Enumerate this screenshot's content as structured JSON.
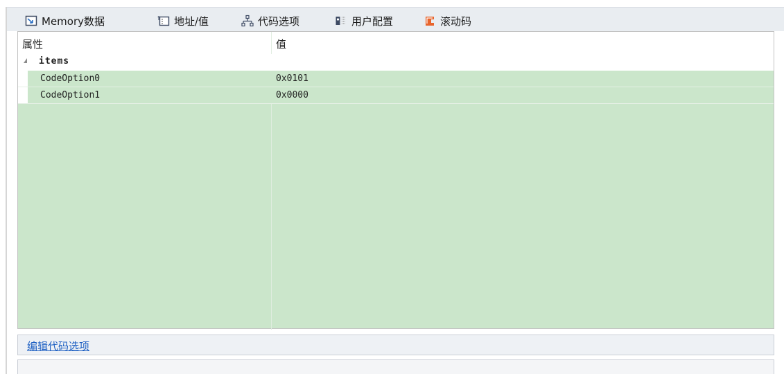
{
  "tabs": [
    {
      "label": "Memory数据",
      "icon": "memory-icon",
      "active": false
    },
    {
      "label": "地址/值",
      "icon": "address-icon",
      "active": false
    },
    {
      "label": "代码选项",
      "icon": "code-option-icon",
      "active": true
    },
    {
      "label": "用户配置",
      "icon": "user-config-icon",
      "active": false
    },
    {
      "label": "滚动码",
      "icon": "rolling-code-icon",
      "active": false
    }
  ],
  "grid": {
    "columns": [
      "属性",
      "值"
    ],
    "category": "items",
    "rows": [
      {
        "name": "CodeOption0",
        "value": "0x0101"
      },
      {
        "name": "CodeOption1",
        "value": "0x0000"
      }
    ]
  },
  "description": {
    "link": "编辑代码选项"
  },
  "colors": {
    "accent_green": "#cbe6cb",
    "link_blue": "#1b5ec2",
    "rolling_icon_orange": "#e8642c"
  }
}
